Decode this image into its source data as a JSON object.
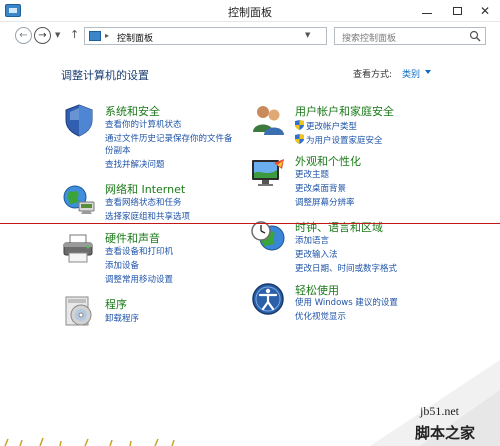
{
  "window": {
    "title": "控制面板"
  },
  "address": {
    "path": "控制面板",
    "search_placeholder": "搜索控制面板"
  },
  "main": {
    "heading": "调整计算机的设置",
    "view_by_label": "查看方式:",
    "view_by_value": "类别"
  },
  "categories": {
    "system_security": {
      "title": "系统和安全",
      "links": [
        "查看你的计算机状态",
        "通过文件历史记录保存你的文件备",
        "份副本",
        "查找并解决问题"
      ]
    },
    "network": {
      "title": "网络和 Internet",
      "links": [
        "查看网络状态和任务",
        "选择家庭组和共享选项"
      ]
    },
    "hardware": {
      "title": "硬件和声音",
      "links": [
        "查看设备和打印机",
        "添加设备",
        "调整常用移动设置"
      ]
    },
    "programs": {
      "title": "程序",
      "links": [
        "卸载程序"
      ]
    },
    "user_accounts": {
      "title": "用户帐户和家庭安全",
      "links": [
        "更改帐户类型",
        "为用户设置家庭安全"
      ]
    },
    "appearance": {
      "title": "外观和个性化",
      "links": [
        "更改主题",
        "更改桌面背景",
        "调整屏幕分辨率"
      ]
    },
    "clock": {
      "title": "时钟、语言和区域",
      "links": [
        "添加语言",
        "更改输入法",
        "更改日期、时间或数字格式"
      ]
    },
    "ease": {
      "title": "轻松使用",
      "links": [
        "使用 Windows 建议的设置",
        "优化视觉显示"
      ]
    }
  },
  "watermark": {
    "site": "jb51.net",
    "name": "脚本之家"
  },
  "colors": {
    "title_green": "#1a7a18",
    "link_blue": "#1f54a8",
    "heading_blue": "#1a3e72",
    "annotation_red": "#c21818"
  }
}
